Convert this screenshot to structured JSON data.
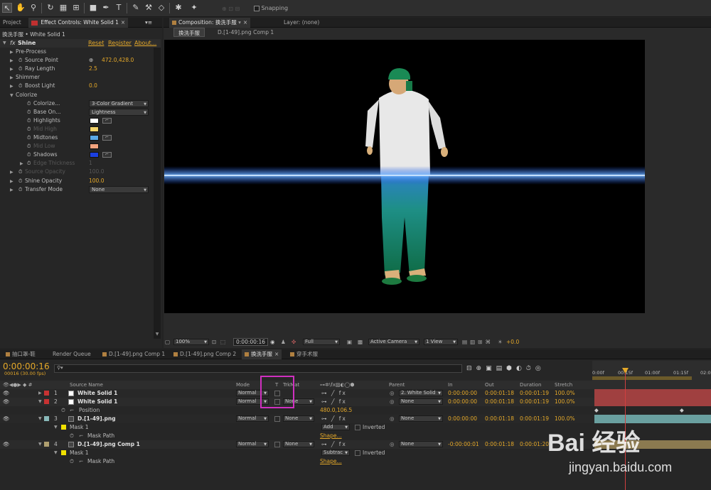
{
  "toolbar": {
    "snapping_label": "Snapping"
  },
  "project_tab": "Project",
  "effect_controls": {
    "tab_label": "Effect Controls: White Solid 1",
    "breadcrumb": "换洗手服 • White Solid 1",
    "effect_name": "Shine",
    "reset": "Reset",
    "register": "Register",
    "about": "About...",
    "rows": [
      {
        "label": "Pre-Process",
        "type": "group"
      },
      {
        "label": "Source Point",
        "type": "point",
        "value": "472.0,428.0"
      },
      {
        "label": "Ray Length",
        "type": "value",
        "value": "2.5"
      },
      {
        "label": "Shimmer",
        "type": "group"
      },
      {
        "label": "Boost Light",
        "type": "value",
        "value": "0.0"
      },
      {
        "label": "Colorize",
        "type": "group-open"
      },
      {
        "label": "Colorize...",
        "type": "dropdown",
        "value": "3-Color Gradient"
      },
      {
        "label": "Base On...",
        "type": "dropdown",
        "value": "Lightness"
      },
      {
        "label": "Highlights",
        "type": "color",
        "color": "#ffffff"
      },
      {
        "label": "Mid High",
        "type": "color-dis",
        "color": "#f2d36a"
      },
      {
        "label": "Midtones",
        "type": "color",
        "color": "#5aa8e6"
      },
      {
        "label": "Mid Low",
        "type": "color-dis",
        "color": "#f2a37e"
      },
      {
        "label": "Shadows",
        "type": "color",
        "color": "#1b3fe0"
      },
      {
        "label": "Edge Thickness",
        "type": "value-dis",
        "value": "1"
      },
      {
        "label": "Source Opacity",
        "type": "value-dis",
        "value": "100.0"
      },
      {
        "label": "Shine Opacity",
        "type": "value",
        "value": "100.0"
      },
      {
        "label": "Transfer Mode",
        "type": "dropdown",
        "value": "None"
      }
    ]
  },
  "composition": {
    "tab_label": "Composition: 换洗手服",
    "layer_tab": "Layer: (none)",
    "subtabs": [
      "换洗手服",
      "D.[1-49].png Comp 1"
    ],
    "zoom": "100%",
    "timecode": "0:00:00:16",
    "resolution": "Full",
    "camera": "Active Camera",
    "view": "1 View",
    "exposure": "+0.0"
  },
  "timeline": {
    "tabs": [
      "抽口罩-鞋",
      "Render Queue",
      "D.[1-49].png Comp 1",
      "D.[1-49].png Comp 2",
      "换洗手服",
      "穿手术服"
    ],
    "timecode": "0:00:00:16",
    "frame_info": "00016 (30.00 fps)",
    "headers": {
      "source": "Source Name",
      "mode": "Mode",
      "t": "T",
      "trkmat": "TrkMat",
      "parent": "Parent",
      "in": "In",
      "out": "Out",
      "duration": "Duration",
      "stretch": "Stretch"
    },
    "ruler": [
      "0:00f",
      "00:15f",
      "01:00f",
      "01:15f",
      "02:0"
    ],
    "layers": [
      {
        "num": "1",
        "name": "White Solid 1",
        "label_color": "#c83232",
        "mode": "Normal",
        "trkmat": "",
        "parent": "2. White Solid",
        "in": "0:00:00:00",
        "out": "0:00:01:18",
        "duration": "0:00:01:19",
        "stretch": "100.0%"
      },
      {
        "num": "2",
        "name": "White Solid 1",
        "label_color": "#c83232",
        "mode": "Normal",
        "trkmat": "None",
        "parent": "None",
        "in": "0:00:00:00",
        "out": "0:00:01:18",
        "duration": "0:00:01:19",
        "stretch": "100.0%"
      },
      {
        "num": "3",
        "name": "D.[1-49].png",
        "label_color": "#89b9b9",
        "mode": "Normal",
        "trkmat": "None",
        "parent": "None",
        "in": "0:00:00:00",
        "out": "0:00:01:18",
        "duration": "0:00:01:19",
        "stretch": "100.0%"
      },
      {
        "num": "4",
        "name": "D.[1-49].png Comp 1",
        "label_color": "#b0a070",
        "mode": "Normal",
        "trkmat": "None",
        "parent": "None",
        "in": "-0:00:00:01",
        "out": "0:00:01:18",
        "duration": "0:00:01:20",
        "stretch": ""
      }
    ],
    "sub": {
      "position": "Position",
      "position_val": "480.0,106.5",
      "mask": "Mask 1",
      "mask_path": "Mask Path",
      "add": "Add",
      "subtract": "Subtrac",
      "inverted": "Inverted",
      "shape": "Shape..."
    }
  },
  "watermark": {
    "brand": "Bai 经验",
    "url": "jingyan.baidu.com"
  }
}
